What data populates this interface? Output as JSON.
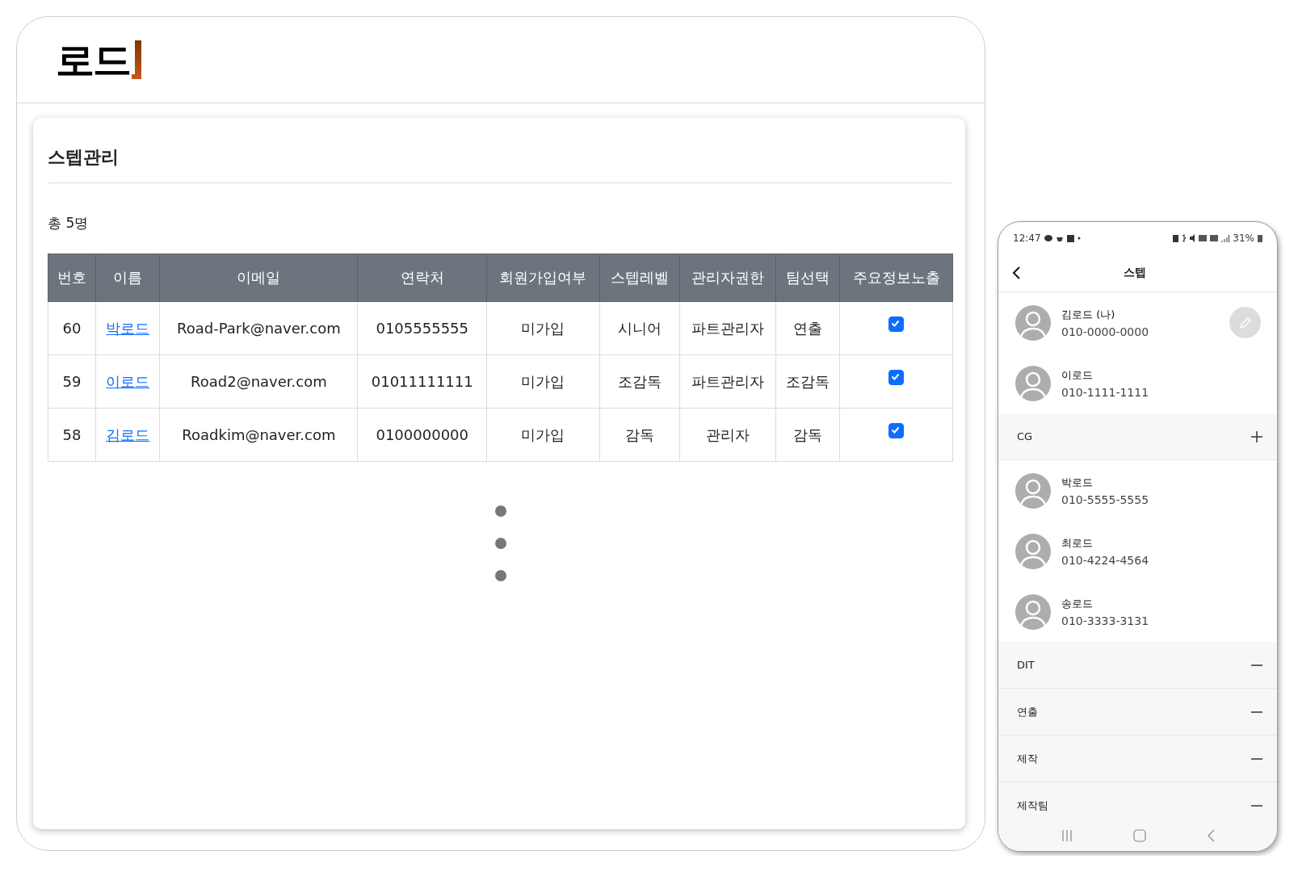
{
  "logo": {
    "text": "로드"
  },
  "page": {
    "title": "스텝관리",
    "total": "총 5명"
  },
  "table": {
    "columns": [
      "번호",
      "이름",
      "이메일",
      "연락처",
      "회원가입여부",
      "스텝레벨",
      "관리자권한",
      "팀선택",
      "주요정보노출"
    ],
    "rows": [
      {
        "no": "60",
        "name": "박로드",
        "email": "Road-Park@naver.com",
        "phone": "0105555555",
        "joined": "미가입",
        "level": "시니어",
        "role": "파트관리자",
        "team": "연출",
        "exposed": true
      },
      {
        "no": "59",
        "name": "이로드",
        "email": "Road2@naver.com",
        "phone": "01011111111",
        "joined": "미가입",
        "level": "조감독",
        "role": "파트관리자",
        "team": "조감독",
        "exposed": true
      },
      {
        "no": "58",
        "name": "김로드",
        "email": "Roadkim@naver.com",
        "phone": "0100000000",
        "joined": "미가입",
        "level": "감독",
        "role": "관리자",
        "team": "감독",
        "exposed": true
      }
    ]
  },
  "phone": {
    "status_bar": {
      "time": "12:47",
      "battery": "31%"
    },
    "title": "스텝",
    "me": [
      {
        "name": "김로드 (나)",
        "phone": "010-0000-0000",
        "editable": true
      },
      {
        "name": "이로드",
        "phone": "010-1111-1111",
        "editable": false
      }
    ],
    "groups": [
      {
        "name": "CG",
        "expanded": true,
        "members": [
          {
            "name": "박로드",
            "phone": "010-5555-5555"
          },
          {
            "name": "최로드",
            "phone": "010-4224-4564"
          },
          {
            "name": "송로드",
            "phone": "010-3333-3131"
          }
        ]
      },
      {
        "name": "DIT",
        "expanded": false
      },
      {
        "name": "연출",
        "expanded": false
      },
      {
        "name": "제작",
        "expanded": false
      },
      {
        "name": "제작팀",
        "expanded": false
      }
    ]
  }
}
